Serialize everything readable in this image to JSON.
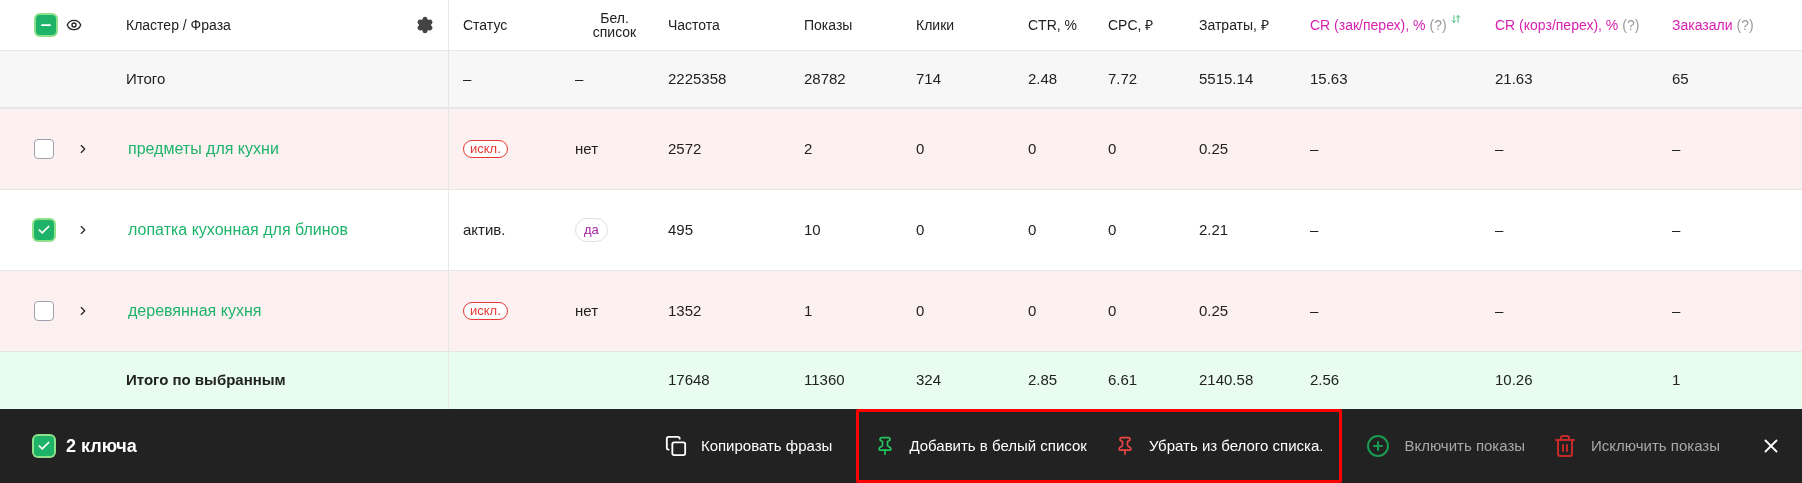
{
  "header": {
    "select_all_indeterminate": true,
    "phrase_label": "Кластер / Фраза",
    "columns": [
      {
        "label": "Статус",
        "accent": false
      },
      {
        "label": "Бел. список",
        "accent": false
      },
      {
        "label": "Частота",
        "accent": false
      },
      {
        "label": "Показы",
        "accent": false
      },
      {
        "label": "Клики",
        "accent": false
      },
      {
        "label": "CTR, %",
        "accent": false
      },
      {
        "label": "CPC, ₽",
        "accent": false
      },
      {
        "label": "Затраты, ₽",
        "accent": false
      },
      {
        "label": "CR (зак/перех), %",
        "accent": true,
        "help": "(?)",
        "sortable": true
      },
      {
        "label": "CR (корз/перех), %",
        "accent": true,
        "help": "(?)"
      },
      {
        "label": "Заказали",
        "accent": true,
        "help": "(?)"
      }
    ]
  },
  "total": {
    "label": "Итого",
    "status": "–",
    "whitelist": "–",
    "values": [
      "2225358",
      "28782",
      "714",
      "2.48",
      "7.72",
      "5515.14",
      "15.63",
      "21.63",
      "65"
    ]
  },
  "rows": [
    {
      "checked": false,
      "phrase": "предметы для кухни",
      "status": {
        "kind": "excluded",
        "text": "искл."
      },
      "whitelist": {
        "kind": "text",
        "text": "нет"
      },
      "values": [
        "2572",
        "2",
        "0",
        "0",
        "0",
        "0.25",
        "–",
        "–",
        "–"
      ]
    },
    {
      "checked": true,
      "phrase": "лопатка кухонная для блинов",
      "status": {
        "kind": "text",
        "text": "актив."
      },
      "whitelist": {
        "kind": "badge",
        "text": "да"
      },
      "values": [
        "495",
        "10",
        "0",
        "0",
        "0",
        "2.21",
        "–",
        "–",
        "–"
      ]
    },
    {
      "checked": false,
      "phrase": "деревянная кухня",
      "status": {
        "kind": "excluded",
        "text": "искл."
      },
      "whitelist": {
        "kind": "text",
        "text": "нет"
      },
      "values": [
        "1352",
        "1",
        "0",
        "0",
        "0",
        "0.25",
        "–",
        "–",
        "–"
      ]
    }
  ],
  "selected_total": {
    "label": "Итого по выбранным",
    "values": [
      "17648",
      "11360",
      "324",
      "2.85",
      "6.61",
      "2140.58",
      "2.56",
      "10.26",
      "1"
    ]
  },
  "action_bar": {
    "checked": true,
    "count": "2 ключа",
    "action_groups": [
      {
        "highlighted": false,
        "actions": [
          {
            "kind": "copy",
            "label": "Копировать фразы",
            "disabled": false
          }
        ]
      },
      {
        "highlighted": true,
        "actions": [
          {
            "kind": "pin-add",
            "label": "Добавить в белый список",
            "disabled": false
          },
          {
            "kind": "pin-remove",
            "label": "Убрать из белого списка.",
            "disabled": false
          }
        ]
      },
      {
        "highlighted": false,
        "actions": [
          {
            "kind": "enable",
            "label": "Включить показы",
            "disabled": true
          },
          {
            "kind": "exclude",
            "label": "Исключить показы",
            "disabled": true
          }
        ]
      }
    ]
  }
}
